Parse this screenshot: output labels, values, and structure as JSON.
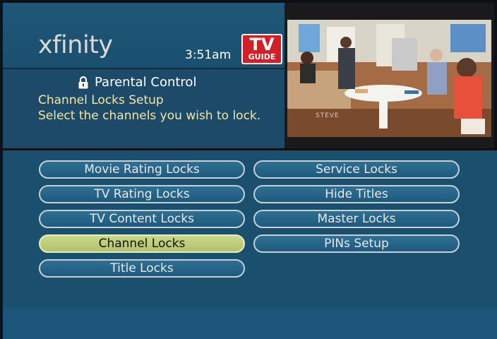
{
  "header": {
    "brand": "xfinity",
    "time": "3:51am",
    "badge_top": "TV",
    "badge_bottom": "GUIDE"
  },
  "description": {
    "title": "Parental Control",
    "subtitle": "Channel Locks Setup",
    "text": "Select the channels you wish to lock."
  },
  "video": {
    "caption": "STEVE"
  },
  "menu": {
    "left": [
      {
        "label": "Movie Rating Locks",
        "selected": false
      },
      {
        "label": "TV Rating Locks",
        "selected": false
      },
      {
        "label": "TV Content Locks",
        "selected": false
      },
      {
        "label": "Channel Locks",
        "selected": true
      },
      {
        "label": "Title Locks",
        "selected": false
      }
    ],
    "right": [
      {
        "label": "Service Locks",
        "selected": false
      },
      {
        "label": "Hide Titles",
        "selected": false
      },
      {
        "label": "Master Locks",
        "selected": false
      },
      {
        "label": "PINs Setup",
        "selected": false
      }
    ]
  },
  "colors": {
    "panel": "#1b4f6e",
    "selected_button": "#c2cf7e",
    "description_text": "#f2e7a8",
    "badge_red": "#d31f26"
  }
}
